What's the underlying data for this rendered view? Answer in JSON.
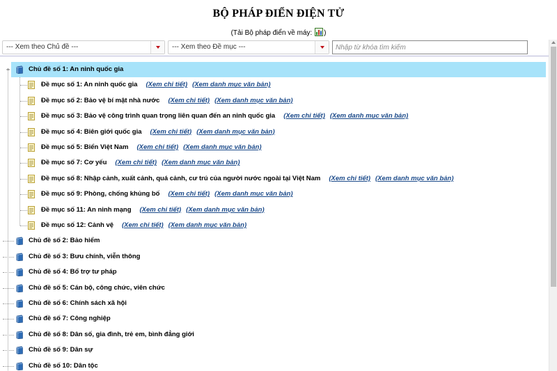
{
  "header": {
    "title": "BỘ PHÁP ĐIỂN ĐIỆN TỬ",
    "download_prefix": "(Tải Bộ pháp điển về máy: ",
    "download_suffix": ")",
    "download_icon": "excel-icon"
  },
  "filters": {
    "topic_select": "--- Xem theo Chủ đề ---",
    "item_select": "--- Xem theo Đề mục ---",
    "search_placeholder": "Nhập từ khóa tìm kiếm"
  },
  "links": {
    "detail": "(Xem chi tiết)",
    "catalog": "(Xem danh mục văn bản)"
  },
  "tree": {
    "expanded_topic": "Chủ đề số 1: An ninh quốc gia",
    "items": [
      "Đề mục số 1: An ninh quốc gia",
      "Đề mục số 2: Bảo vệ bí mật nhà nước",
      "Đề mục số 3: Bảo vệ công trình quan trọng liên quan đến an ninh quốc gia",
      "Đề mục số 4: Biên giới quốc gia",
      "Đề mục số 5: Biển Việt Nam",
      "Đề mục số 7: Cơ yếu",
      "Đề mục số 8: Nhập cảnh, xuất cảnh, quá cảnh, cư trú của người nước ngoài tại Việt Nam",
      "Đề mục số 9: Phòng, chống khủng bố",
      "Đề mục số 11: An ninh mạng",
      "Đề mục số 12: Cảnh vệ"
    ],
    "topics": [
      "Chủ đề số 2: Bảo hiểm",
      "Chủ đề số 3: Bưu chính, viễn thông",
      "Chủ đề số 4: Bổ trợ tư pháp",
      "Chủ đề số 5: Cán bộ, công chức, viên chức",
      "Chủ đề số 6: Chính sách xã hội",
      "Chủ đề số 7: Công nghiệp",
      "Chủ đề số 8: Dân số, gia đình, trẻ em, bình đẳng giới",
      "Chủ đề số 9: Dân sự",
      "Chủ đề số 10: Dân tộc"
    ],
    "expand_glyph": "+",
    "collapse_glyph": "−"
  },
  "colors": {
    "selected_row": "#a7e3fa",
    "link": "#1b4a8a",
    "dropdown_arrow": "#c0131a"
  }
}
